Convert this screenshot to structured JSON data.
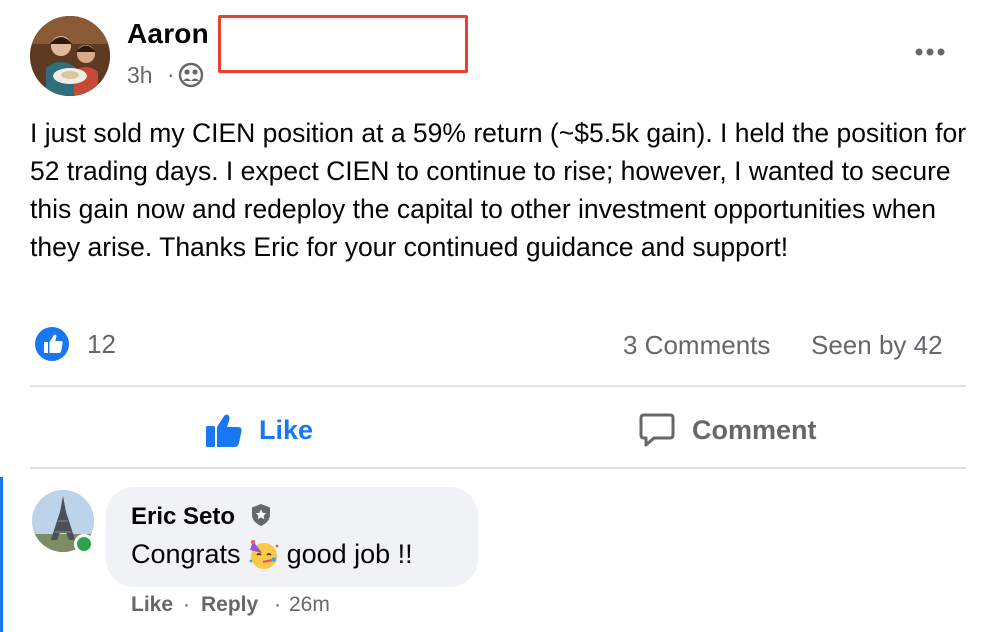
{
  "post": {
    "author": "Aaron",
    "time": "3h",
    "separator": "·",
    "audience_icon": "group-icon",
    "more_icon": "more-horizontal-icon",
    "text": "I just sold my CIEN position at a 59% return (~$5.5k gain). I held the position for 52 trading days.  I expect CIEN to continue to rise; however, I wanted to secure this gain now and redeploy the capital to other investment opportunities when they arise. Thanks Eric for your continued guidance and support!"
  },
  "stats": {
    "reaction_icon": "like-reaction-icon",
    "likes": "12",
    "comments": "3 Comments",
    "seen_by": "Seen by 42"
  },
  "actions": {
    "like_label": "Like",
    "comment_label": "Comment"
  },
  "comment": {
    "author": "Eric Seto",
    "badge_icon": "admin-shield-icon",
    "text_before": "Congrats",
    "emoji": "partying-face-emoji",
    "text_after": "good job !!",
    "like_label": "Like",
    "reply_label": "Reply",
    "separator": "·",
    "time": "26m",
    "online": true
  },
  "colors": {
    "accent": "#1877f2",
    "secondary_text": "#65676b",
    "bubble": "#f0f2f5",
    "divider": "#dfe1e5",
    "online": "#31a24c",
    "redaction_border": "#e8412f"
  }
}
